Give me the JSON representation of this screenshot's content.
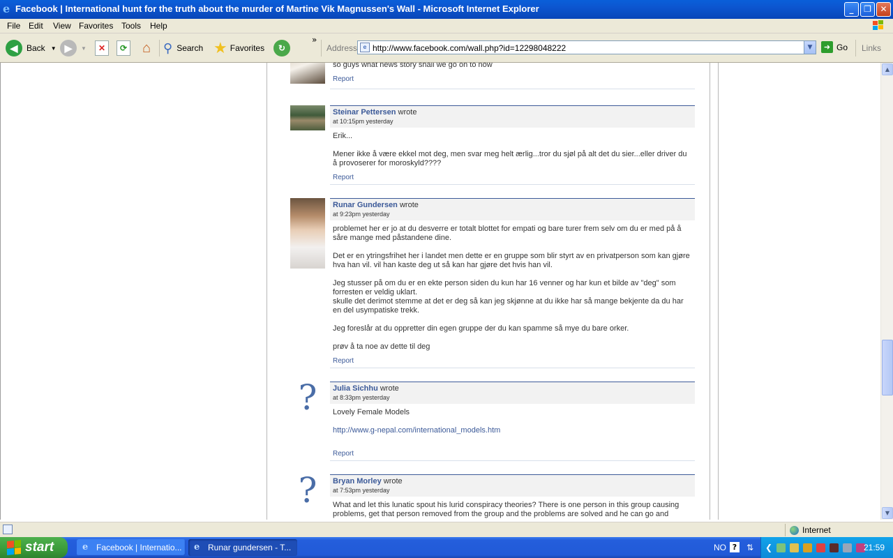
{
  "window": {
    "title": "Facebook | International hunt for the truth about the murder of Martine Vik Magnussen's Wall - Microsoft Internet Explorer",
    "minimize": "_",
    "maximize": "❐",
    "close": "✕"
  },
  "menu": [
    "File",
    "Edit",
    "View",
    "Favorites",
    "Tools",
    "Help"
  ],
  "toolbar": {
    "back": "Back",
    "search": "Search",
    "favorites": "Favorites",
    "more": "»",
    "address_label": "Address",
    "url": "http://www.facebook.com/wall.php?id=12298048222",
    "go": "Go",
    "links": "Links"
  },
  "posts": [
    {
      "author": "",
      "wrote": "",
      "time": "",
      "paragraphs": [
        "so guys what news story shall we go on to now"
      ],
      "report": "Report"
    },
    {
      "author": "Steinar Pettersen",
      "wrote": "wrote",
      "time": "at 10:15pm yesterday",
      "paragraphs": [
        "Erik...",
        "Mener ikke å være ekkel mot deg, men svar meg helt ærlig...tror du sjøl på alt det du sier...eller driver du å provoserer for moroskyld????"
      ],
      "report": "Report"
    },
    {
      "author": "Runar Gundersen",
      "wrote": "wrote",
      "time": "at 9:23pm yesterday",
      "paragraphs": [
        "problemet her er jo at du desverre er totalt blottet for empati og bare turer frem selv om du er med på å såre mange med påstandene dine.",
        "Det er en ytringsfrihet her i landet men dette er en gruppe som blir styrt av en privatperson som kan gjøre hva han vil. vil han kaste deg ut så kan har gjøre det hvis han vil.",
        "Jeg stusser på om du er en ekte person siden du kun har 16 venner og har kun et bilde av \"deg\" som forresten er veldig uklart.\nskulle det derimot stemme at det er deg så kan jeg skjønne at du ikke har så mange bekjente da du har en del usympatiske trekk.",
        "Jeg foreslår at du oppretter din egen gruppe der du kan spamme så mye du bare orker.",
        "prøv å ta noe av dette til deg"
      ],
      "report": "Report"
    },
    {
      "author": "Julia Sichhu",
      "wrote": "wrote",
      "time": "at 8:33pm yesterday",
      "paragraphs": [
        "Lovely Female Models"
      ],
      "link": "http://www.g-nepal.com/international_models.htm",
      "report": "Report"
    },
    {
      "author": "Bryan Morley",
      "wrote": "wrote",
      "time": "at 7:53pm yesterday",
      "paragraphs": [
        "What and let this lunatic spout his lurid conspiracy theories? There is one person in this group causing problems, get that person removed from the group and the problems are solved and he can go and ramble"
      ],
      "report": ""
    }
  ],
  "unknown_avatar_glyph": "?",
  "status": {
    "zone": "Internet"
  },
  "taskbar": {
    "start": "start",
    "tasks": [
      "Facebook | Internatio...",
      "Runar gundersen - T..."
    ],
    "lang": "NO",
    "help": "?",
    "clock": "21:59"
  },
  "colors": {
    "facebook_blue": "#3b5998",
    "xp_blue": "#245edc",
    "start_green": "#3a9a39"
  }
}
